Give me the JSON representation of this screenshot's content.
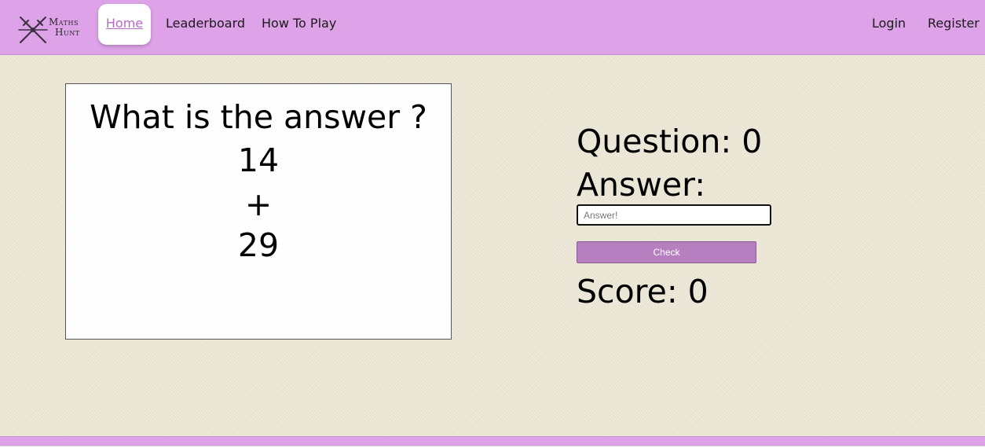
{
  "colors": {
    "navbar": "#dda2e7",
    "page_background": "#ece7d6",
    "home_link": "#b46cc4",
    "check_button": "#b57fc0"
  },
  "logo": {
    "line1": "Maths",
    "line2": "Hunt",
    "icon": "crossed-swords-icon"
  },
  "nav": {
    "home": "Home",
    "leaderboard": "Leaderboard",
    "how_to_play": "How To Play",
    "login": "Login",
    "register": "Register"
  },
  "question_card": {
    "title": "What is the answer ?",
    "operand1": "14",
    "operator": "+",
    "operand2": "29"
  },
  "panel": {
    "question_label": "Question: 0",
    "answer_label": "Answer:",
    "answer_placeholder": "Answer!",
    "answer_value": "",
    "check_label": "Check",
    "score_label": "Score: 0"
  }
}
